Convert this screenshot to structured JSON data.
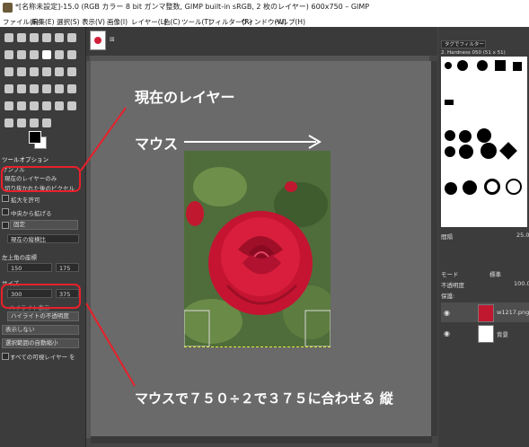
{
  "window": {
    "title": "*[名称未設定]-15.0 (RGB カラー 8 bit ガンマ整数, GIMP built-in sRGB, 2 枚のレイヤー) 600x750 – GIMP"
  },
  "menu": [
    "ファイル(F)",
    "編集(E)",
    "選択(S)",
    "表示(V)",
    "画像(I)",
    "レイヤー(L)",
    "色(C)",
    "ツール(T)",
    "フィルター(R)",
    "ウィンドウ(W)",
    "ヘルプ(H)"
  ],
  "tool_options": {
    "header": "ツールオプション",
    "section": "サンプル",
    "radio_current_layer": "現在のレイヤーのみ",
    "radio_merged": "切り抜かれた後のピクセル",
    "check_allow_grow": "拡大を許可",
    "check_from_center": "中央から拡げる",
    "fixed_label": "固定",
    "fixed_value": "現在の縦横比",
    "position_label": "左上角の座標",
    "pos_x": "150",
    "pos_y": "175",
    "size_label": "サイズ",
    "size_w": "300",
    "size_h": "375",
    "highlight_check": "ハイライト表示",
    "highlight_opacity": "ハイライトの不透明度",
    "guide_value": "表示しない",
    "auto_shrink": "選択範囲の自動縮小",
    "merged_check": "すべての可視レイヤー を"
  },
  "image_tab": {
    "close": "⊠"
  },
  "brushes": {
    "tag_placeholder": "タグでフィルター",
    "brush_name": "2. Hardness 050 (51 x 51)",
    "spacing_label": "間隔",
    "spacing_value": "25.0"
  },
  "layers": {
    "mode_label": "モード",
    "mode_value": "標準",
    "opacity_label": "不透明度",
    "opacity_value": "100.0",
    "lock_label": "保護:",
    "items": [
      {
        "name": "w1217.png"
      },
      {
        "name": "背景"
      }
    ]
  },
  "annotations": {
    "current_layer": "現在のレイヤー",
    "mouse": "マウス",
    "instruction": "マウスで７５０÷２で３７５に合わせる 縦"
  },
  "colors": {
    "annotation_red": "#e8202a",
    "rose": "#d0203a"
  }
}
